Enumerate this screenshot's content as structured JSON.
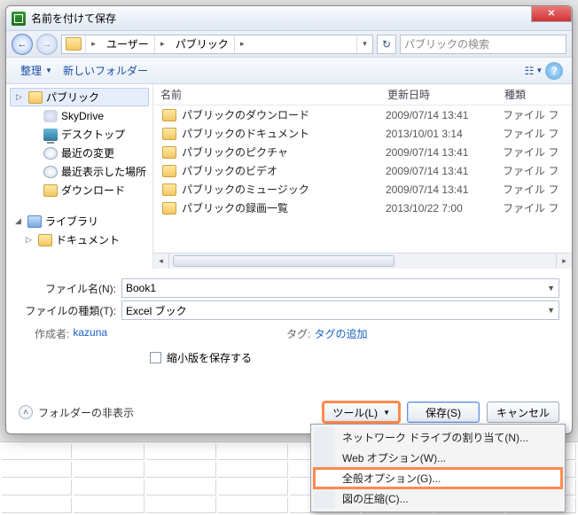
{
  "window": {
    "title": "名前を付けて保存",
    "close": "✕"
  },
  "nav": {
    "back": "←",
    "forward": "→",
    "path_user": "ユーザー",
    "path_public": "パブリック",
    "refresh": "↻",
    "search_placeholder": "パブリックの検索"
  },
  "toolbar": {
    "organize": "整理",
    "newfolder": "新しいフォルダー",
    "view": "☷",
    "help": "?"
  },
  "tree": {
    "items": [
      {
        "icon": "ic-folder",
        "label": "パブリック",
        "sel": true,
        "exp": "▷"
      },
      {
        "icon": "ic-cloud",
        "label": "SkyDrive"
      },
      {
        "icon": "ic-screen",
        "label": "デスクトップ"
      },
      {
        "icon": "ic-clock",
        "label": "最近の変更"
      },
      {
        "icon": "ic-clock",
        "label": "最近表示した場所"
      },
      {
        "icon": "ic-folder",
        "label": "ダウンロード"
      }
    ],
    "group_label": "ライブラリ",
    "group_exp": "◢",
    "doc_label": "ドキュメント",
    "doc_exp": "▷"
  },
  "columns": {
    "name": "名前",
    "date": "更新日時",
    "type": "種類"
  },
  "files": [
    {
      "name": "パブリックのダウンロード",
      "date": "2009/07/14 13:41",
      "type": "ファイル フ"
    },
    {
      "name": "パブリックのドキュメント",
      "date": "2013/10/01 3:14",
      "type": "ファイル フ"
    },
    {
      "name": "パブリックのピクチャ",
      "date": "2009/07/14 13:41",
      "type": "ファイル フ"
    },
    {
      "name": "パブリックのビデオ",
      "date": "2009/07/14 13:41",
      "type": "ファイル フ"
    },
    {
      "name": "パブリックのミュージック",
      "date": "2009/07/14 13:41",
      "type": "ファイル フ"
    },
    {
      "name": "パブリックの録画一覧",
      "date": "2013/10/22 7:00",
      "type": "ファイル フ"
    }
  ],
  "form": {
    "filename_label": "ファイル名(N):",
    "filename_value": "Book1",
    "filetype_label": "ファイルの種類(T):",
    "filetype_value": "Excel ブック",
    "author_label": "作成者:",
    "author_value": "kazuna",
    "tag_label": "タグ:",
    "tag_value": "タグの追加",
    "thumb_label": "縮小版を保存する"
  },
  "footer": {
    "hide": "フォルダーの非表示",
    "tools": "ツール(L)",
    "save": "保存(S)",
    "cancel": "キャンセル"
  },
  "menu": {
    "items": [
      "ネットワーク ドライブの割り当て(N)...",
      "Web オプション(W)...",
      "全般オプション(G)...",
      "図の圧縮(C)..."
    ]
  }
}
